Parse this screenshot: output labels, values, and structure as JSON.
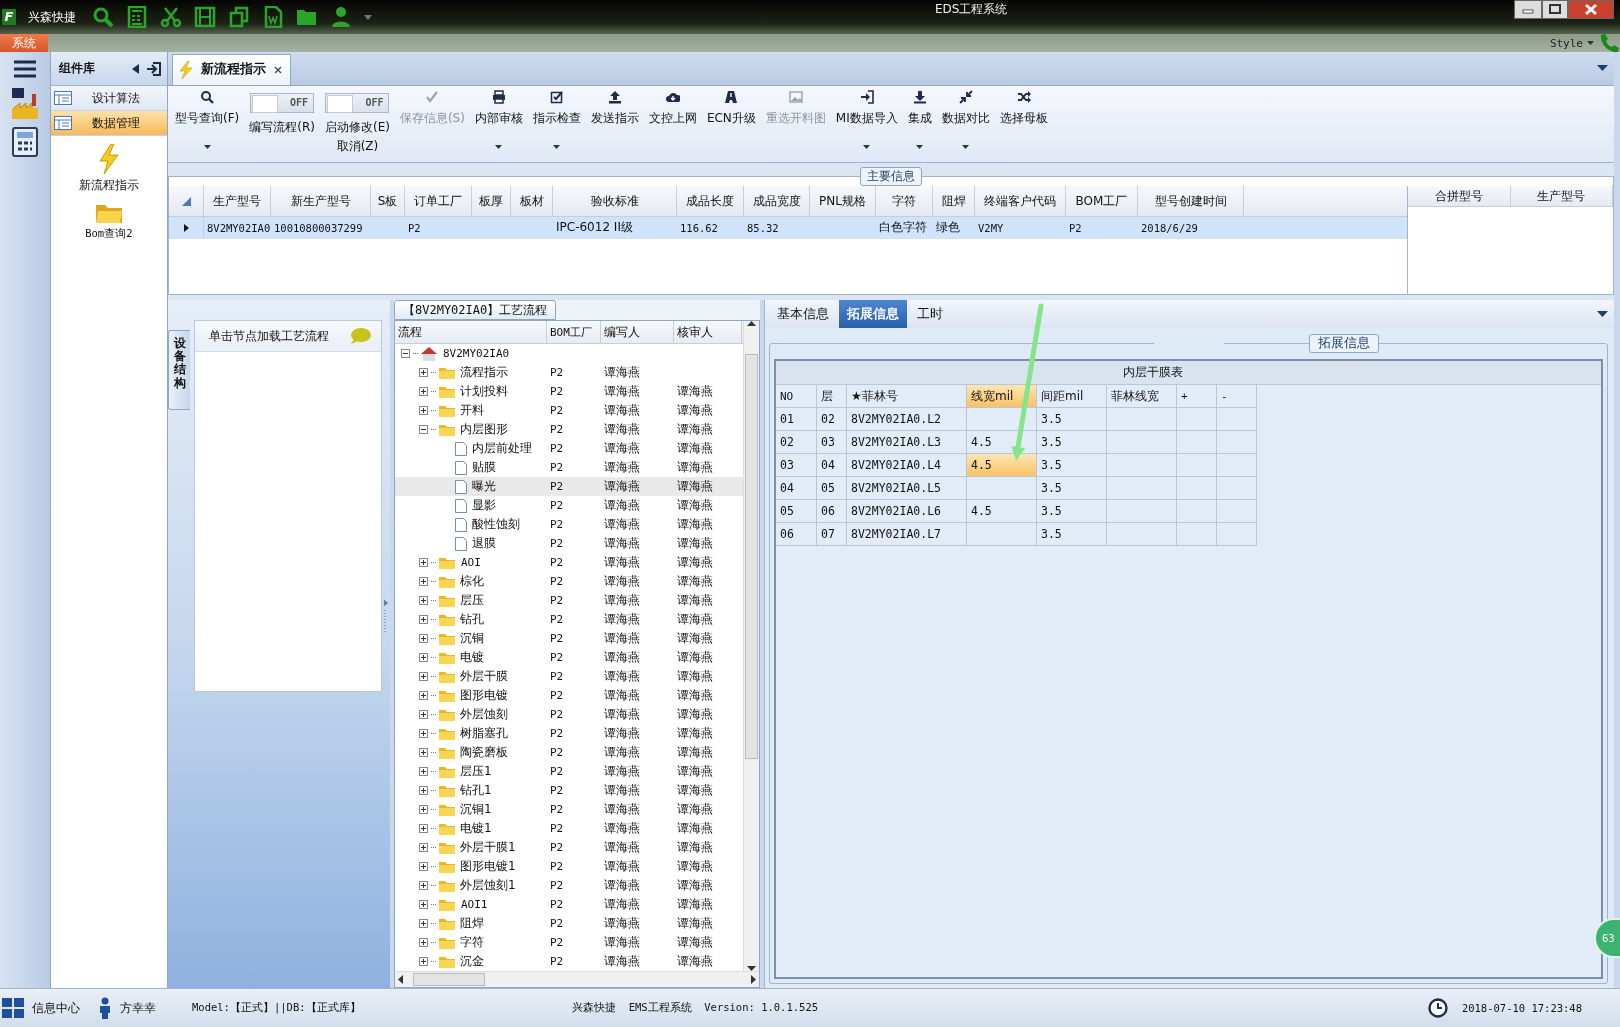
{
  "window": {
    "logo": "F",
    "app_name": "兴森快捷",
    "title": "EDS工程系统",
    "menu_tab": "系统",
    "style_menu": "Style"
  },
  "sidebar": {
    "title": "组件库",
    "items": [
      {
        "label": "设计算法",
        "selected": false
      },
      {
        "label": "数据管理",
        "selected": true
      }
    ],
    "tools": [
      {
        "kind": "lightning",
        "label": "新流程指示"
      },
      {
        "kind": "folder",
        "label": "Bom查询2"
      }
    ]
  },
  "doc_tabs": [
    {
      "label": "新流程指示",
      "selected": true
    }
  ],
  "toolbar": [
    {
      "kind": "button",
      "label": "型号查询(F)",
      "disabled": false,
      "dropdown": true
    },
    {
      "kind": "toggle",
      "label": "编写流程(R)",
      "on": false,
      "state_text": "OFF"
    },
    {
      "kind": "toggle",
      "label": "启动修改(E)",
      "sublabel": "取消(Z)",
      "on": false,
      "state_text": "OFF"
    },
    {
      "kind": "button",
      "label": "保存信息(S)",
      "disabled": true,
      "dropdown": false
    },
    {
      "kind": "button",
      "label": "内部审核",
      "disabled": false,
      "dropdown": true
    },
    {
      "kind": "button",
      "label": "指示检查",
      "disabled": false,
      "dropdown": true
    },
    {
      "kind": "button",
      "label": "发送指示",
      "disabled": false,
      "dropdown": false
    },
    {
      "kind": "button",
      "label": "文控上网",
      "disabled": false,
      "dropdown": false
    },
    {
      "kind": "button",
      "label": "ECN升级",
      "disabled": false,
      "dropdown": false
    },
    {
      "kind": "button",
      "label": "重选开料图",
      "disabled": true,
      "dropdown": false
    },
    {
      "kind": "button",
      "label": "MI数据导入",
      "disabled": false,
      "dropdown": true
    },
    {
      "kind": "button",
      "label": "集成",
      "disabled": false,
      "dropdown": true
    },
    {
      "kind": "button",
      "label": "数据对比",
      "disabled": false,
      "dropdown": true
    },
    {
      "kind": "button",
      "label": "选择母板",
      "disabled": false,
      "dropdown": false
    }
  ],
  "main_info": {
    "title": "主要信息",
    "columns": [
      "生产型号",
      "新生产型号",
      "S板",
      "订单工厂",
      "板厚",
      "板材",
      "验收标准",
      "成品长度",
      "成品宽度",
      "PNL规格",
      "字符",
      "阻焊",
      "终端客户代码",
      "BOM工厂",
      "型号创建时间"
    ],
    "rows": [
      {
        "selected": true,
        "cells": [
          "8V2MY02IA0",
          "10010800037299",
          null,
          "P2",
          null,
          null,
          "IPC-6012 II级",
          "116.62",
          "85.32",
          null,
          "白色字符",
          "绿色",
          "V2MY",
          "P2",
          "2018/6/29"
        ]
      }
    ],
    "side_columns": [
      "合拼型号",
      "生产型号"
    ]
  },
  "device_panel": {
    "tab": "设备结构",
    "hint": "单击节点加载工艺流程"
  },
  "flow": {
    "title": "【8V2MY02IA0】工艺流程",
    "columns": [
      "流程",
      "BOM工厂",
      "编写人",
      "核审人"
    ],
    "tree": {
      "kind": "root",
      "label": "8V2MY02IA0",
      "expanded": true,
      "selected": false,
      "children": [
        {
          "kind": "folder",
          "label": "流程指示",
          "factory": "P2",
          "writer": "谭海燕",
          "expanded": false,
          "selected": false
        },
        {
          "kind": "folder",
          "label": "计划投料",
          "factory": "P2",
          "writer": "谭海燕",
          "reviewer": "谭海燕",
          "expanded": false,
          "selected": false
        },
        {
          "kind": "folder",
          "label": "开料",
          "factory": "P2",
          "writer": "谭海燕",
          "reviewer": "谭海燕",
          "expanded": false,
          "selected": false
        },
        {
          "kind": "folder",
          "label": "内层图形",
          "factory": "P2",
          "writer": "谭海燕",
          "reviewer": "谭海燕",
          "expanded": true,
          "selected": false,
          "children": [
            {
              "kind": "doc",
              "label": "内层前处理",
              "factory": "P2",
              "writer": "谭海燕",
              "reviewer": "谭海燕",
              "selected": false
            },
            {
              "kind": "doc",
              "label": "贴膜",
              "factory": "P2",
              "writer": "谭海燕",
              "reviewer": "谭海燕",
              "selected": false
            },
            {
              "kind": "doc",
              "label": "曝光",
              "factory": "P2",
              "writer": "谭海燕",
              "reviewer": "谭海燕",
              "selected": true
            },
            {
              "kind": "doc",
              "label": "显影",
              "factory": "P2",
              "writer": "谭海燕",
              "reviewer": "谭海燕",
              "selected": false
            },
            {
              "kind": "doc",
              "label": "酸性蚀刻",
              "factory": "P2",
              "writer": "谭海燕",
              "reviewer": "谭海燕",
              "selected": false
            },
            {
              "kind": "doc",
              "label": "退膜",
              "factory": "P2",
              "writer": "谭海燕",
              "reviewer": "谭海燕",
              "selected": false
            }
          ]
        },
        {
          "kind": "folder",
          "label": "AOI",
          "factory": "P2",
          "writer": "谭海燕",
          "reviewer": "谭海燕",
          "expanded": false,
          "selected": false
        },
        {
          "kind": "folder",
          "label": "棕化",
          "factory": "P2",
          "writer": "谭海燕",
          "reviewer": "谭海燕",
          "expanded": false,
          "selected": false
        },
        {
          "kind": "folder",
          "label": "层压",
          "factory": "P2",
          "writer": "谭海燕",
          "reviewer": "谭海燕",
          "expanded": false,
          "selected": false
        },
        {
          "kind": "folder",
          "label": "钻孔",
          "factory": "P2",
          "writer": "谭海燕",
          "reviewer": "谭海燕",
          "expanded": false,
          "selected": false
        },
        {
          "kind": "folder",
          "label": "沉铜",
          "factory": "P2",
          "writer": "谭海燕",
          "reviewer": "谭海燕",
          "expanded": false,
          "selected": false
        },
        {
          "kind": "folder",
          "label": "电镀",
          "factory": "P2",
          "writer": "谭海燕",
          "reviewer": "谭海燕",
          "expanded": false,
          "selected": false
        },
        {
          "kind": "folder",
          "label": "外层干膜",
          "factory": "P2",
          "writer": "谭海燕",
          "reviewer": "谭海燕",
          "expanded": false,
          "selected": false
        },
        {
          "kind": "folder",
          "label": "图形电镀",
          "factory": "P2",
          "writer": "谭海燕",
          "reviewer": "谭海燕",
          "expanded": false,
          "selected": false
        },
        {
          "kind": "folder",
          "label": "外层蚀刻",
          "factory": "P2",
          "writer": "谭海燕",
          "reviewer": "谭海燕",
          "expanded": false,
          "selected": false
        },
        {
          "kind": "folder",
          "label": "树脂塞孔",
          "factory": "P2",
          "writer": "谭海燕",
          "reviewer": "谭海燕",
          "expanded": false,
          "selected": false
        },
        {
          "kind": "folder",
          "label": "陶瓷磨板",
          "factory": "P2",
          "writer": "谭海燕",
          "reviewer": "谭海燕",
          "expanded": false,
          "selected": false
        },
        {
          "kind": "folder",
          "label": "层压1",
          "factory": "P2",
          "writer": "谭海燕",
          "reviewer": "谭海燕",
          "expanded": false,
          "selected": false
        },
        {
          "kind": "folder",
          "label": "钻孔1",
          "factory": "P2",
          "writer": "谭海燕",
          "reviewer": "谭海燕",
          "expanded": false,
          "selected": false
        },
        {
          "kind": "folder",
          "label": "沉铜1",
          "factory": "P2",
          "writer": "谭海燕",
          "reviewer": "谭海燕",
          "expanded": false,
          "selected": false
        },
        {
          "kind": "folder",
          "label": "电镀1",
          "factory": "P2",
          "writer": "谭海燕",
          "reviewer": "谭海燕",
          "expanded": false,
          "selected": false
        },
        {
          "kind": "folder",
          "label": "外层干膜1",
          "factory": "P2",
          "writer": "谭海燕",
          "reviewer": "谭海燕",
          "expanded": false,
          "selected": false
        },
        {
          "kind": "folder",
          "label": "图形电镀1",
          "factory": "P2",
          "writer": "谭海燕",
          "reviewer": "谭海燕",
          "expanded": false,
          "selected": false
        },
        {
          "kind": "folder",
          "label": "外层蚀刻1",
          "factory": "P2",
          "writer": "谭海燕",
          "reviewer": "谭海燕",
          "expanded": false,
          "selected": false
        },
        {
          "kind": "folder",
          "label": "AOI1",
          "factory": "P2",
          "writer": "谭海燕",
          "reviewer": "谭海燕",
          "expanded": false,
          "selected": false
        },
        {
          "kind": "folder",
          "label": "阻焊",
          "factory": "P2",
          "writer": "谭海燕",
          "reviewer": "谭海燕",
          "expanded": false,
          "selected": false
        },
        {
          "kind": "folder",
          "label": "字符",
          "factory": "P2",
          "writer": "谭海燕",
          "reviewer": "谭海燕",
          "expanded": false,
          "selected": false
        },
        {
          "kind": "folder",
          "label": "沉金",
          "factory": "P2",
          "writer": "谭海燕",
          "reviewer": "谭海燕",
          "expanded": false,
          "selected": false
        }
      ]
    }
  },
  "ext": {
    "tabs": [
      {
        "label": "基本信息",
        "selected": false
      },
      {
        "label": "拓展信息",
        "selected": true
      },
      {
        "label": "工时",
        "selected": false
      }
    ],
    "group_title": "拓展信息",
    "table": {
      "title": "内层干膜表",
      "columns": [
        {
          "label": "NO",
          "selected": false
        },
        {
          "label": "层",
          "selected": false
        },
        {
          "label": "★菲林号",
          "selected": false
        },
        {
          "label": "线宽mil",
          "selected": true
        },
        {
          "label": "间距mil",
          "selected": false
        },
        {
          "label": "菲林线宽",
          "selected": false
        },
        {
          "label": "+",
          "selected": false
        },
        {
          "label": "-",
          "selected": false
        }
      ],
      "rows": [
        {
          "selected": false,
          "cells": [
            "01",
            "02",
            "8V2MY02IA0.L2",
            null,
            "3.5",
            null,
            null,
            null
          ]
        },
        {
          "selected": false,
          "cells": [
            "02",
            "03",
            "8V2MY02IA0.L3",
            "4.5",
            "3.5",
            null,
            null,
            null
          ]
        },
        {
          "selected": true,
          "cells": [
            "03",
            "04",
            "8V2MY02IA0.L4",
            "4.5",
            "3.5",
            null,
            null,
            null
          ]
        },
        {
          "selected": false,
          "cells": [
            "04",
            "05",
            "8V2MY02IA0.L5",
            null,
            "3.5",
            null,
            null,
            null
          ]
        },
        {
          "selected": false,
          "cells": [
            "05",
            "06",
            "8V2MY02IA0.L6",
            "4.5",
            "3.5",
            null,
            null,
            null
          ]
        },
        {
          "selected": false,
          "cells": [
            "06",
            "07",
            "8V2MY02IA0.L7",
            null,
            "3.5",
            null,
            null,
            null
          ]
        }
      ]
    }
  },
  "badge": {
    "text": "63"
  },
  "status_bar": {
    "info": "信息中心",
    "user": "方幸幸",
    "model": "Model:【正式】||DB:【正式库】",
    "app": "兴森快捷  EMS工程系统  Version: 1.0.1.525",
    "datetime": "2018-07-10 17:23:48"
  }
}
